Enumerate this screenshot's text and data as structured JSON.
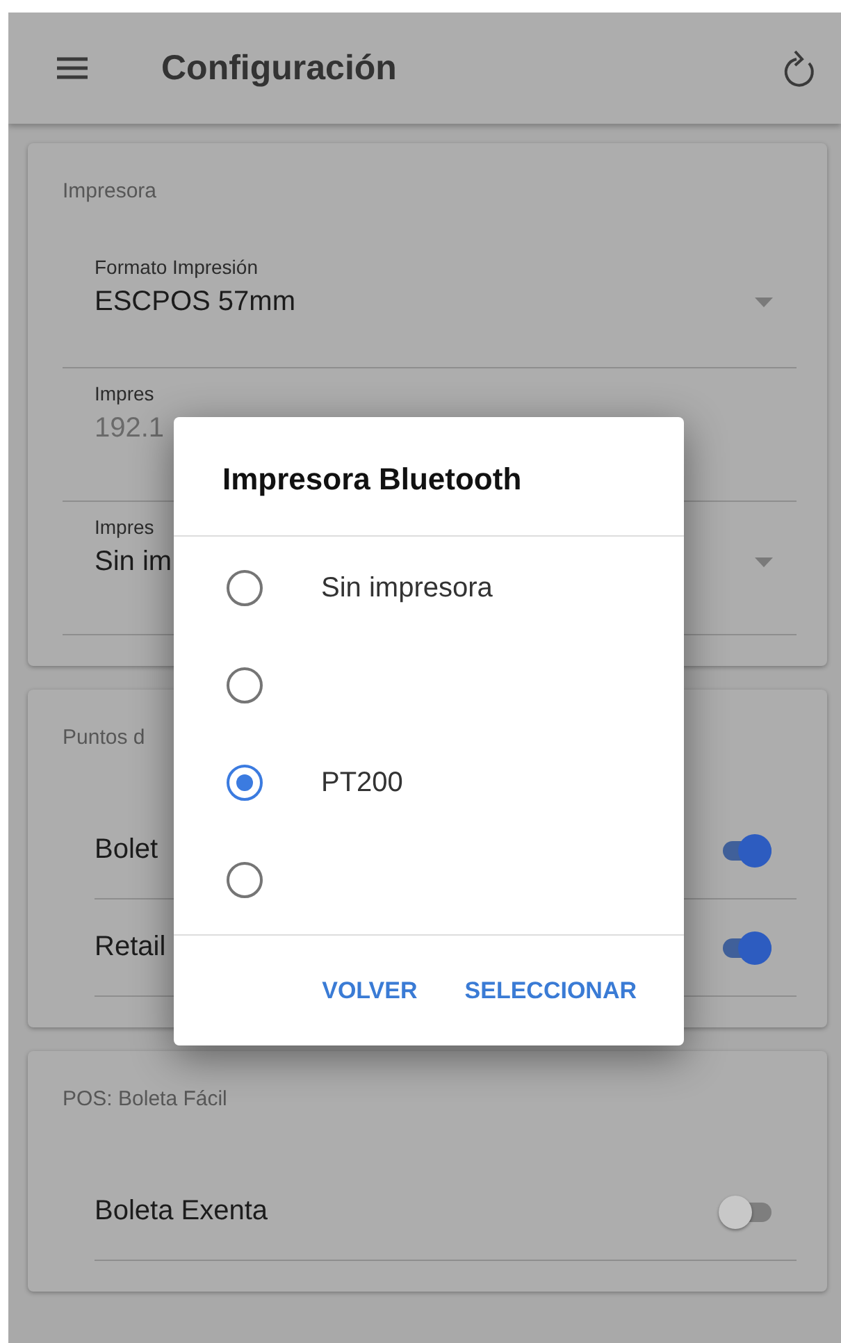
{
  "app_bar": {
    "title": "Configuración"
  },
  "sections": [
    {
      "title": "Impresora",
      "items": [
        {
          "kind": "select",
          "label": "Formato Impresión",
          "value": "ESCPOS 57mm",
          "disabled": false
        },
        {
          "kind": "text",
          "label": "Impres",
          "value": "192.1",
          "disabled": true
        },
        {
          "kind": "select",
          "label": "Impres",
          "value": "Sin im",
          "disabled": false
        }
      ]
    },
    {
      "title": "Puntos d",
      "items": [
        {
          "kind": "switch",
          "label": "Bolet",
          "on": true
        },
        {
          "kind": "switch",
          "label": "Retail",
          "on": true
        }
      ]
    },
    {
      "title": "POS: Boleta Fácil",
      "items": [
        {
          "kind": "switch",
          "label": "Boleta Exenta",
          "on": false
        }
      ]
    }
  ],
  "dialog": {
    "title": "Impresora Bluetooth",
    "options": [
      {
        "label": "Sin impresora",
        "selected": false
      },
      {
        "selected": false
      },
      {
        "label": "PT200",
        "selected": true
      },
      {
        "selected": false
      }
    ],
    "buttons": [
      "VOLVER",
      "SELECCIONAR"
    ]
  }
}
